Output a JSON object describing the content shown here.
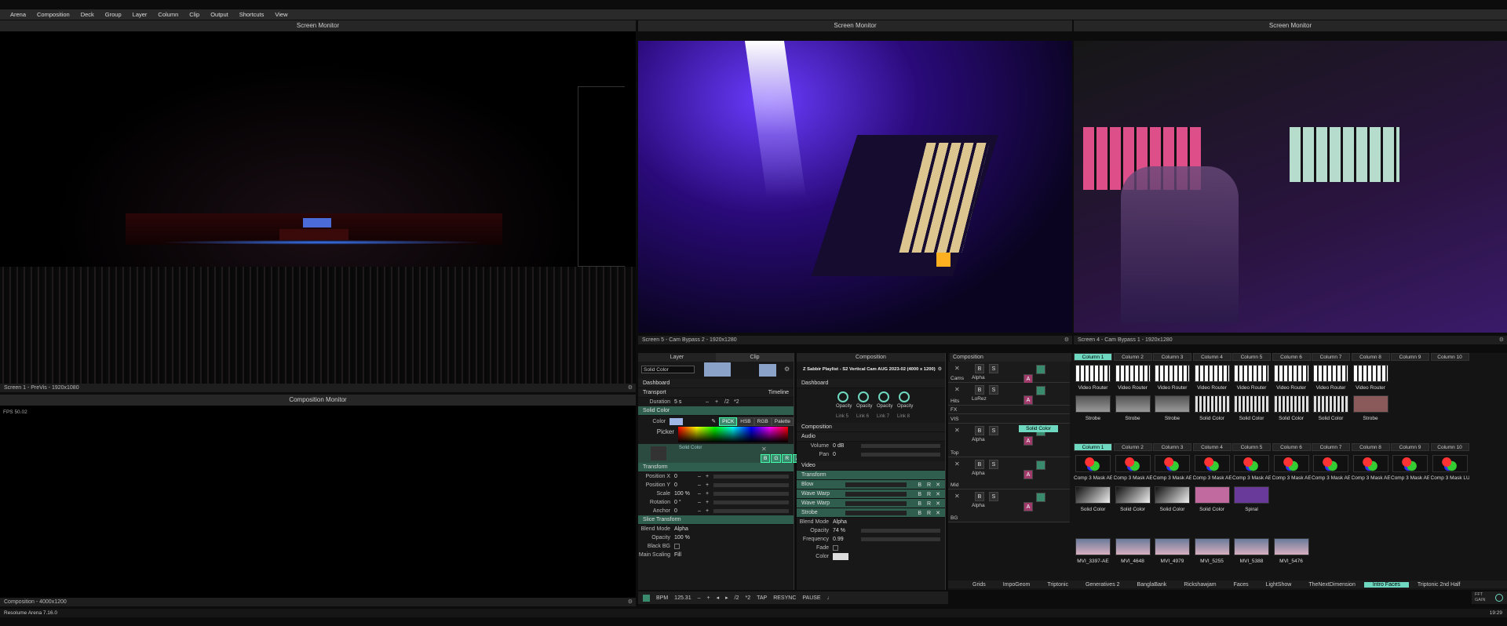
{
  "menu": [
    "Arena",
    "Composition",
    "Deck",
    "Group",
    "Layer",
    "Column",
    "Clip",
    "Output",
    "Shortcuts",
    "View"
  ],
  "monitors": {
    "left_title": "Screen Monitor",
    "left_footer": "Screen 1 - PreVis - 1920x1080",
    "mid_title": "Screen Monitor",
    "mid_footer": "Screen 5 - Cam Bypass 2 - 1920x1280",
    "right_title": "Screen Monitor",
    "right_footer": "Screen 4 - Cam Bypass 1 - 1920x1280"
  },
  "comp_monitor": {
    "title": "Composition Monitor",
    "fps": "FPS 50.02",
    "footer": "Composition - 4000x1200"
  },
  "status": {
    "app": "Resolume Arena 7.16.0",
    "time": "19:29"
  },
  "layer_panel": {
    "tab_layer": "Layer",
    "tab_clip": "Clip",
    "clip_name": "Solid Color",
    "dashboard": "Dashboard",
    "transport": "Transport",
    "timeline": "Timeline",
    "duration_label": "Duration",
    "duration_val": "5 s",
    "div2": "/2",
    "mul2": "*2",
    "solid_color": "Solid Color",
    "color_label": "Color",
    "picker_label": "Picker",
    "pick": "PICK",
    "hsb": "HSB",
    "rgb": "RGB",
    "palette": "Palette",
    "swatch_label": "Solid Color",
    "bgra": [
      "B",
      "G",
      "R",
      "A"
    ],
    "transform": "Transform",
    "rows": [
      {
        "label": "Position X",
        "val": "0"
      },
      {
        "label": "Position Y",
        "val": "0"
      },
      {
        "label": "Scale",
        "val": "100 %"
      },
      {
        "label": "Rotation",
        "val": "0 °"
      },
      {
        "label": "Anchor",
        "val": "0"
      }
    ],
    "slice": "Slice Transform",
    "blend_label": "Blend Mode",
    "blend_val": "Alpha",
    "opacity_label": "Opacity",
    "opacity_val": "100 %",
    "blackbg_label": "Black BG",
    "mainscale_label": "Main Scaling",
    "mainscale_val": "Fill"
  },
  "comp_panel": {
    "tab": "Composition",
    "name": "Z Sabbir Playlist - S2 Vertical Cam AUG 2023-02 (4000 x 1200)",
    "dashboard": "Dashboard",
    "knobs": [
      "Opacity",
      "Opacity",
      "Opacity",
      "Opacity"
    ],
    "links": [
      "Link 5",
      "Link 6",
      "Link 7",
      "Link 8"
    ],
    "composition": "Composition",
    "audio": "Audio",
    "volume_label": "Volume",
    "volume_val": "0 dB",
    "pan_label": "Pan",
    "pan_val": "0",
    "video": "Video",
    "transform": "Transform",
    "effects": [
      "Blow",
      "Wave Warp",
      "Wave Warp",
      "Strobe"
    ],
    "blend_label": "Blend Mode",
    "blend_val": "Alpha",
    "opacity_label": "Opacity",
    "opacity_val": "74 %",
    "freq_label": "Frequency",
    "freq_val": "0.99",
    "fade_label": "Fade",
    "color_label": "Color"
  },
  "transport": {
    "bpm_label": "BPM",
    "bpm": "125.31",
    "div2": "/2",
    "mul2": "*2",
    "tap": "TAP",
    "resync": "RESYNC",
    "pause": "PAUSE"
  },
  "deck": {
    "comp_label": "Composition",
    "columns": [
      "Column 1",
      "Column 2",
      "Column 3",
      "Column 4",
      "Column 5",
      "Column 6",
      "Column 7",
      "Column 8",
      "Column 9",
      "Column 10"
    ],
    "layers": [
      {
        "name": "Cams",
        "blend": "Alpha"
      },
      {
        "name": "Hits",
        "blend": "LoRez"
      },
      {
        "name": "FX",
        "blend": ""
      },
      {
        "name": "VIS",
        "blend": "Alpha"
      },
      {
        "name": "Top",
        "blend": "Alpha"
      },
      {
        "name": "Mid",
        "blend": "Alpha"
      },
      {
        "name": "BG",
        "blend": "Alpha"
      }
    ],
    "row_cams": [
      "Video Router",
      "Video Router",
      "Video Router",
      "Video Router",
      "Video Router",
      "Video Router",
      "Video Router",
      "Video Router"
    ],
    "row_hits": [
      "Strobe",
      "Strobe",
      "Strobe",
      "Solid Color",
      "Solid Color",
      "Solid Color",
      "Solid Color",
      "Strobe"
    ],
    "hits_layer_clip": "Solid Color",
    "row_top": [
      "Comp 3 Mask AE",
      "Comp 3 Mask AE",
      "Comp 3 Mask AE",
      "Comp 3 Mask AE",
      "Comp 3 Mask AE",
      "Comp 3 Mask AE",
      "Comp 3 Mask AE",
      "Comp 3 Mask AE",
      "Comp 3 Mask AE",
      "Comp 3 Mask LUM"
    ],
    "row_mid": [
      "Solid Color",
      "Solid Color",
      "Solid Color",
      "Solid Color",
      "Spiral"
    ],
    "row_bg": [
      "MVI_3397-AE",
      "MVI_4648",
      "MVI_4979",
      "MVI_5255",
      "MVI_5388",
      "MVI_5476"
    ],
    "tabs": [
      "Grids",
      "ImpoGeom",
      "Triptonic",
      "Generatives 2",
      "BanglaBank",
      "Rickshawjam",
      "Faces",
      "LightShow",
      "TheNextDimension",
      "Intro Faces",
      "Triptonic 2nd Half"
    ],
    "active_tab": "Intro Faces",
    "fft": "FFT",
    "gain": "GAIN"
  },
  "colors": {
    "accent": "#6fd8c0",
    "section": "#2f5e4f",
    "pink": "#a03a6a"
  }
}
